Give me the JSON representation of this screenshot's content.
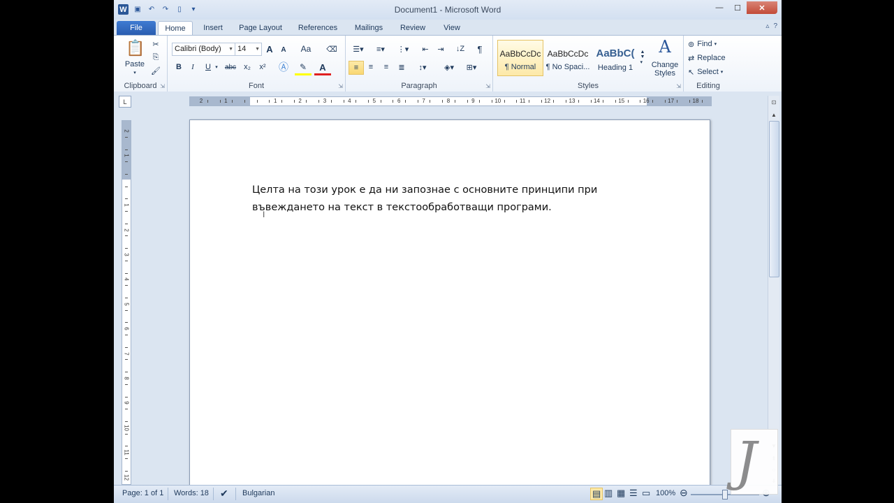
{
  "window": {
    "title": "Document1  -  Microsoft Word",
    "app_icon_letter": "W",
    "minimize": "—",
    "maximize": "☐",
    "close": "✕"
  },
  "tabs": {
    "file": "File",
    "home": "Home",
    "insert": "Insert",
    "page_layout": "Page Layout",
    "references": "References",
    "mailings": "Mailings",
    "review": "Review",
    "view": "View"
  },
  "ribbon": {
    "clipboard": {
      "label": "Clipboard",
      "paste": "Paste"
    },
    "font": {
      "label": "Font",
      "family": "Calibri (Body)",
      "size": "14",
      "grow": "A",
      "shrink": "A",
      "case": "Aa",
      "bold": "B",
      "italic": "I",
      "underline": "U",
      "strike": "abc",
      "sub": "x₂",
      "sup": "x²",
      "color": "A"
    },
    "paragraph": {
      "label": "Paragraph",
      "pilcrow": "¶"
    },
    "styles": {
      "label": "Styles",
      "items": [
        {
          "sample": "AaBbCcDc",
          "name": "¶ Normal"
        },
        {
          "sample": "AaBbCcDc",
          "name": "¶ No Spaci..."
        },
        {
          "sample": "AaBbC(",
          "name": "Heading 1"
        }
      ],
      "change_styles_line1": "Change",
      "change_styles_line2": "Styles"
    },
    "editing": {
      "label": "Editing",
      "find": "Find",
      "replace": "Replace",
      "select": "Select"
    }
  },
  "ruler": {
    "numbers": [
      "2",
      "1",
      "1",
      "2",
      "3",
      "4",
      "5",
      "6",
      "7",
      "8",
      "9",
      "10",
      "11",
      "12",
      "13",
      "14",
      "15",
      "16",
      "17",
      "18"
    ],
    "vnumbers": [
      "2",
      "1",
      "1",
      "2",
      "3",
      "4",
      "5",
      "6",
      "7",
      "8",
      "9",
      "10",
      "11",
      "12"
    ]
  },
  "document": {
    "line1": "Целта на този урок е да ни запознае с основните принципи при",
    "line2": "въвеждането на текст в текстообработващи програми."
  },
  "status": {
    "page": "Page: 1 of 1",
    "words": "Words: 18",
    "language": "Bulgarian",
    "zoom": "100%",
    "zoom_level": 1.0
  },
  "colors": {
    "accent": "#2b579a",
    "file_tab": "#2a5db0"
  }
}
